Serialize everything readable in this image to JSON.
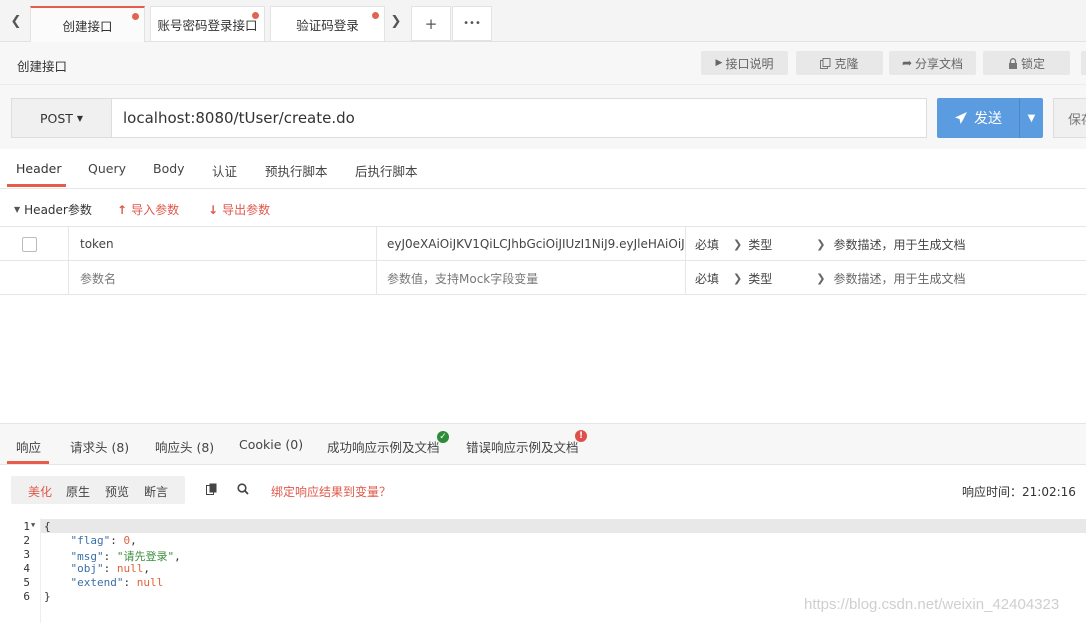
{
  "tabs": {
    "items": [
      {
        "label": "创建接口",
        "active": true,
        "unsaved": true
      },
      {
        "label": "账号密码登录接口",
        "active": false,
        "unsaved": true
      },
      {
        "label": "验证码登录",
        "active": false,
        "unsaved": true
      }
    ],
    "prev_icon": "chevron-left-icon",
    "next_icon": "chevron-right-icon",
    "add_label": "+",
    "more_label": "•••"
  },
  "title_row": {
    "title": "创建接口",
    "buttons": [
      {
        "label": "接口说明",
        "icon": "caret-right-icon"
      },
      {
        "label": "克隆",
        "icon": "copy-icon"
      },
      {
        "label": "分享文档",
        "icon": "share-icon"
      },
      {
        "label": "锁定",
        "icon": "lock-icon"
      }
    ]
  },
  "request": {
    "method": "POST",
    "url": "localhost:8080/tUser/create.do",
    "send_label": "发送",
    "save_label": "保存"
  },
  "request_tabs": [
    "Header",
    "Query",
    "Body",
    "认证",
    "预执行脚本",
    "后执行脚本"
  ],
  "header_bar": {
    "title": "Header参数",
    "import_label": "导入参数",
    "export_label": "导出参数"
  },
  "params": {
    "rows": [
      {
        "name": "token",
        "value": "eyJ0eXAiOiJKV1QiLCJhbGciOiJIUzI1NiJ9.eyJleHAiOiJ",
        "required": "必填",
        "type": "类型",
        "desc": "参数描述，用于生成文档"
      }
    ],
    "placeholder": {
      "name": "参数名",
      "value": "参数值，支持Mock字段变量",
      "required": "必填",
      "type": "类型",
      "desc": "参数描述，用于生成文档"
    }
  },
  "response_tabs": [
    "响应",
    "请求头 (8)",
    "响应头 (8)",
    "Cookie (0)",
    "成功响应示例及文档",
    "错误响应示例及文档"
  ],
  "response_toolbar": {
    "formats": [
      "美化",
      "原生",
      "预览",
      "断言"
    ],
    "bind_label": "绑定响应结果到变量？",
    "time_label": "响应时间：21:02:16"
  },
  "code": {
    "line_numbers": [
      "1",
      "2",
      "3",
      "4",
      "5",
      "6"
    ],
    "open_brace": "{",
    "close_brace": "}",
    "fields": [
      {
        "key": "\"flag\"",
        "value": "0",
        "kind": "n",
        "comma": ","
      },
      {
        "key": "\"msg\"",
        "value": "\"请先登录\"",
        "kind": "s",
        "comma": ","
      },
      {
        "key": "\"obj\"",
        "value": "null",
        "kind": "nul",
        "comma": ","
      },
      {
        "key": "\"extend\"",
        "value": "null",
        "kind": "nul",
        "comma": ""
      }
    ]
  },
  "watermark": "https://blog.csdn.net/weixin_42404323",
  "colors": {
    "accent": "#e55c4b",
    "send": "#5b9bdf",
    "success": "#2e8b3a",
    "error": "#e0504a"
  }
}
